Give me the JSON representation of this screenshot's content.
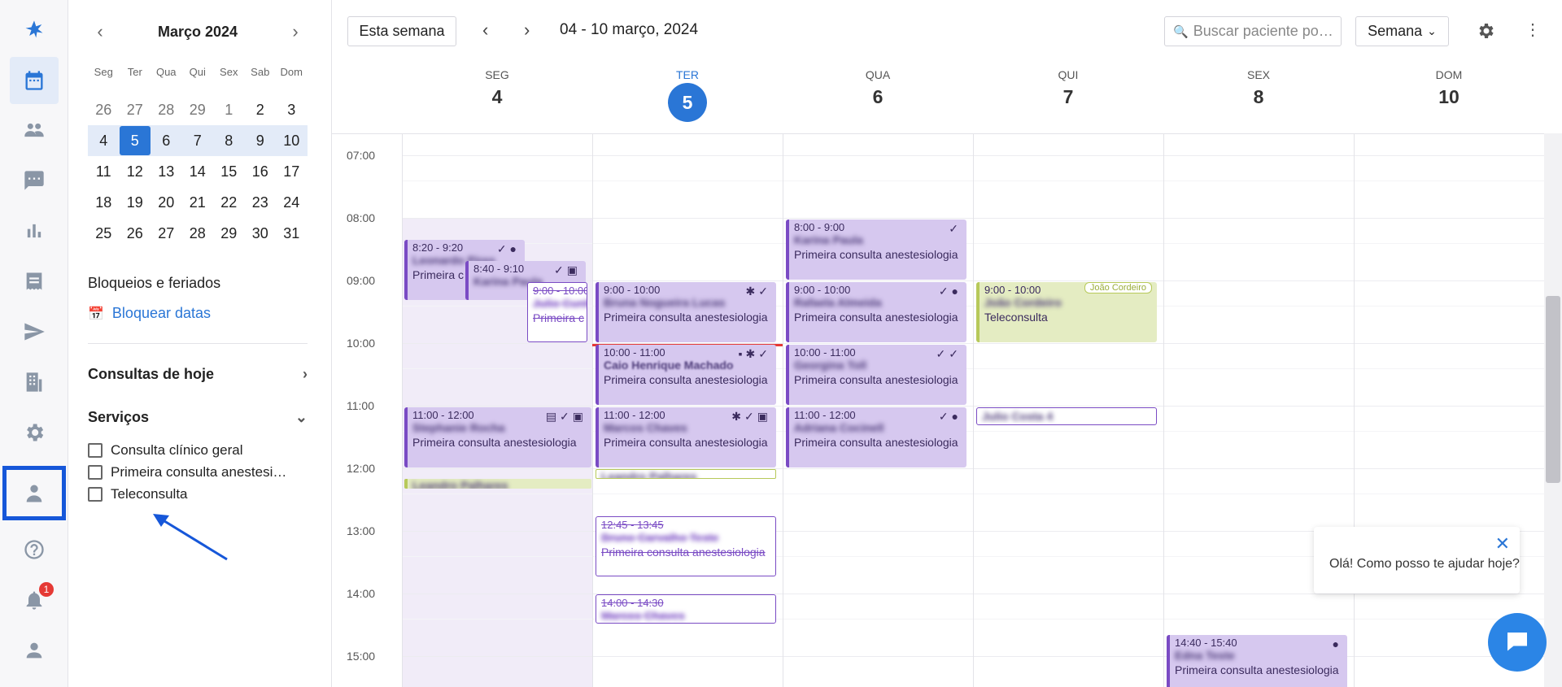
{
  "rail": {
    "items": [
      "calendar-icon",
      "users-icon",
      "chat-icon",
      "chart-icon",
      "receipt-icon",
      "send-icon",
      "building-icon",
      "gear-icon",
      "doctor-icon",
      "help-icon",
      "bell-icon",
      "person-icon"
    ],
    "notification_count": "1"
  },
  "mini_calendar": {
    "month": "Março 2024",
    "weekdays": [
      "Seg",
      "Ter",
      "Qua",
      "Qui",
      "Sex",
      "Sab",
      "Dom"
    ],
    "weeks": [
      [
        "26",
        "27",
        "28",
        "29",
        "1",
        "2",
        "3"
      ],
      [
        "4",
        "5",
        "6",
        "7",
        "8",
        "9",
        "10"
      ],
      [
        "11",
        "12",
        "13",
        "14",
        "15",
        "16",
        "17"
      ],
      [
        "18",
        "19",
        "20",
        "21",
        "22",
        "23",
        "24"
      ],
      [
        "25",
        "26",
        "27",
        "28",
        "29",
        "30",
        "31"
      ]
    ]
  },
  "sidebar": {
    "blocks_title": "Bloqueios e feriados",
    "block_link": "Bloquear datas",
    "today_title": "Consultas de hoje",
    "services_title": "Serviços",
    "services": [
      "Consulta clínico geral",
      "Primeira consulta anestesi…",
      "Teleconsulta"
    ]
  },
  "toolbar": {
    "this_week": "Esta semana",
    "range": "04 - 10 março, 2024",
    "search_placeholder": "Buscar paciente po…",
    "view": "Semana"
  },
  "days": [
    {
      "name": "SEG",
      "num": "4"
    },
    {
      "name": "TER",
      "num": "5"
    },
    {
      "name": "QUA",
      "num": "6"
    },
    {
      "name": "QUI",
      "num": "7"
    },
    {
      "name": "SEX",
      "num": "8"
    },
    {
      "name": "DOM",
      "num": "10"
    }
  ],
  "times": [
    "07:00",
    "08:00",
    "09:00",
    "10:00",
    "11:00",
    "12:00",
    "13:00",
    "14:00",
    "15:00"
  ],
  "events": {
    "mon1": {
      "time": "8:20 - 9:20",
      "name": "Leonardo Pires",
      "service": "Primeira c"
    },
    "mon2": {
      "time": "8:40 - 9:10",
      "name": "Karina Paula"
    },
    "mon3": {
      "time": "9:00 - 10:00",
      "name": "Julio Cunha",
      "service": "Primeira c"
    },
    "mon4": {
      "time": "11:00 - 12:00",
      "name": "Stephanie Rocha",
      "service": "Primeira consulta anestesiologia"
    },
    "mon5": {
      "name": "Leandro Palhares"
    },
    "tue1": {
      "time": "9:00 - 10:00",
      "name": "Bruna Nogueira Lucas",
      "service": "Primeira consulta anestesiologia"
    },
    "tue2": {
      "time": "10:00 - 11:00",
      "name": "Caio Henrique Machado",
      "service": "Primeira consulta anestesiologia"
    },
    "tue3": {
      "time": "11:00 - 12:00",
      "name": "Marcos Chaves",
      "service": "Primeira consulta anestesiologia"
    },
    "tue4": {
      "name": "Leandro Palhares"
    },
    "tue5": {
      "time": "12:45 - 13:45",
      "name": "Bruno Carvalho Teste",
      "service": "Primeira consulta anestesiologia"
    },
    "tue6": {
      "time": "14:00 - 14:30",
      "name": "Marcos Chaves"
    },
    "wed1": {
      "time": "8:00 - 9:00",
      "name": "Karina Paula",
      "service": "Primeira consulta anestesiologia"
    },
    "wed2": {
      "time": "9:00 - 10:00",
      "name": "Rafaela Almeida",
      "service": "Primeira consulta anestesiologia"
    },
    "wed3": {
      "time": "10:00 - 11:00",
      "name": "Georgina Toll",
      "service": "Primeira consulta anestesiologia"
    },
    "wed4": {
      "time": "11:00 - 12:00",
      "name": "Adriana Cocinell",
      "service": "Primeira consulta anestesiologia"
    },
    "thu1": {
      "time": "9:00 - 10:00",
      "name": "João Cordeiro",
      "service": "Teleconsulta",
      "tag": "João Cordeiro"
    },
    "thu2": {
      "name": "Julio Costa 4"
    },
    "fri1": {
      "time": "14:40 - 15:40",
      "name": "Edna Teste",
      "service": "Primeira consulta anestesiologia"
    }
  },
  "chat": {
    "message": "Olá! Como posso te ajudar hoje?"
  }
}
